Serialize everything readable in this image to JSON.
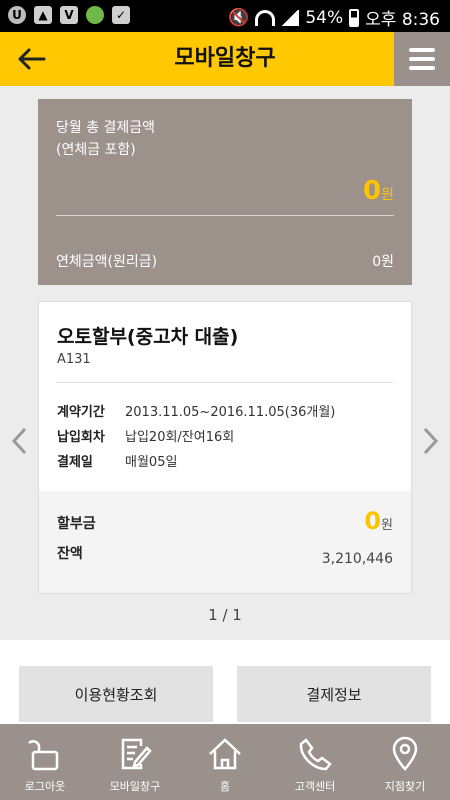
{
  "status_bar": {
    "battery": "54%",
    "time": "오후 8:36"
  },
  "header": {
    "title": "모바일창구"
  },
  "summary": {
    "total_label_line1": "당월 총 결제금액",
    "total_label_line2": "(연체금 포함)",
    "total_amount": "0",
    "total_unit": "원",
    "overdue_label": "연체금액(원리금)",
    "overdue_value": "0원"
  },
  "loan_card": {
    "title": "오토할부(중고차 대출)",
    "code": "A131",
    "rows": [
      {
        "key": "계약기간",
        "value": "2013.11.05~2016.11.05(36개월)"
      },
      {
        "key": "납입회차",
        "value": "납입20회/잔여16회"
      },
      {
        "key": "결제일",
        "value": "매월05일"
      }
    ],
    "installment_label": "할부금",
    "installment_amount": "0",
    "installment_unit": "원",
    "balance_label": "잔액",
    "balance_value": "3,210,446"
  },
  "pager": {
    "text": "1 / 1"
  },
  "buttons": {
    "usage": "이용현황조회",
    "payment": "결제정보"
  },
  "bottom_nav": [
    {
      "label": "로그아웃",
      "icon": "unlock-icon"
    },
    {
      "label": "모바일창구",
      "icon": "document-edit-icon"
    },
    {
      "label": "홈",
      "icon": "home-icon"
    },
    {
      "label": "고객센터",
      "icon": "phone-icon"
    },
    {
      "label": "지점찾기",
      "icon": "location-pin-icon"
    }
  ],
  "colors": {
    "accent": "#ffc800",
    "amount": "#ffc400",
    "panel": "#9d918c"
  }
}
